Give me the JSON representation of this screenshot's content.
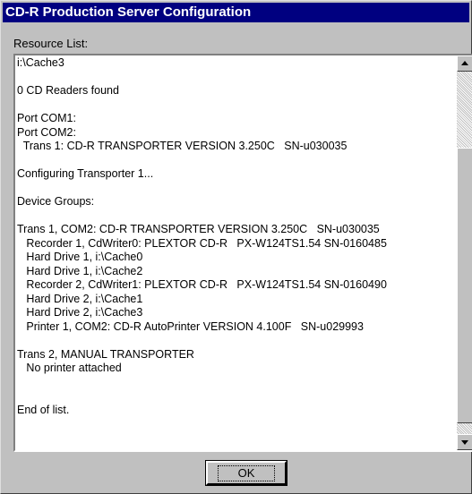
{
  "window": {
    "title": "CD-R Production Server Configuration"
  },
  "resource_list": {
    "label": "Resource List:",
    "lines": [
      "i:\\Cache3",
      "",
      "0 CD Readers found",
      "",
      "Port COM1:",
      "Port COM2:",
      "  Trans 1: CD-R TRANSPORTER VERSION 3.250C   SN-u030035",
      "",
      "Configuring Transporter 1...",
      "",
      "Device Groups:",
      "",
      "Trans 1, COM2: CD-R TRANSPORTER VERSION 3.250C   SN-u030035",
      "   Recorder 1, CdWriter0: PLEXTOR CD-R   PX-W124TS1.54 SN-0160485",
      "   Hard Drive 1, i:\\Cache0",
      "   Hard Drive 1, i:\\Cache2",
      "   Recorder 2, CdWriter1: PLEXTOR CD-R   PX-W124TS1.54 SN-0160490",
      "   Hard Drive 2, i:\\Cache1",
      "   Hard Drive 2, i:\\Cache3",
      "   Printer 1, COM2: CD-R AutoPrinter VERSION 4.100F   SN-u029993",
      "",
      "Trans 2, MANUAL TRANSPORTER",
      "   No printer attached",
      "",
      "",
      "End of list."
    ]
  },
  "buttons": {
    "ok_label": "OK"
  },
  "icons": {
    "scroll_up": "up-arrow-icon",
    "scroll_down": "down-arrow-icon"
  }
}
